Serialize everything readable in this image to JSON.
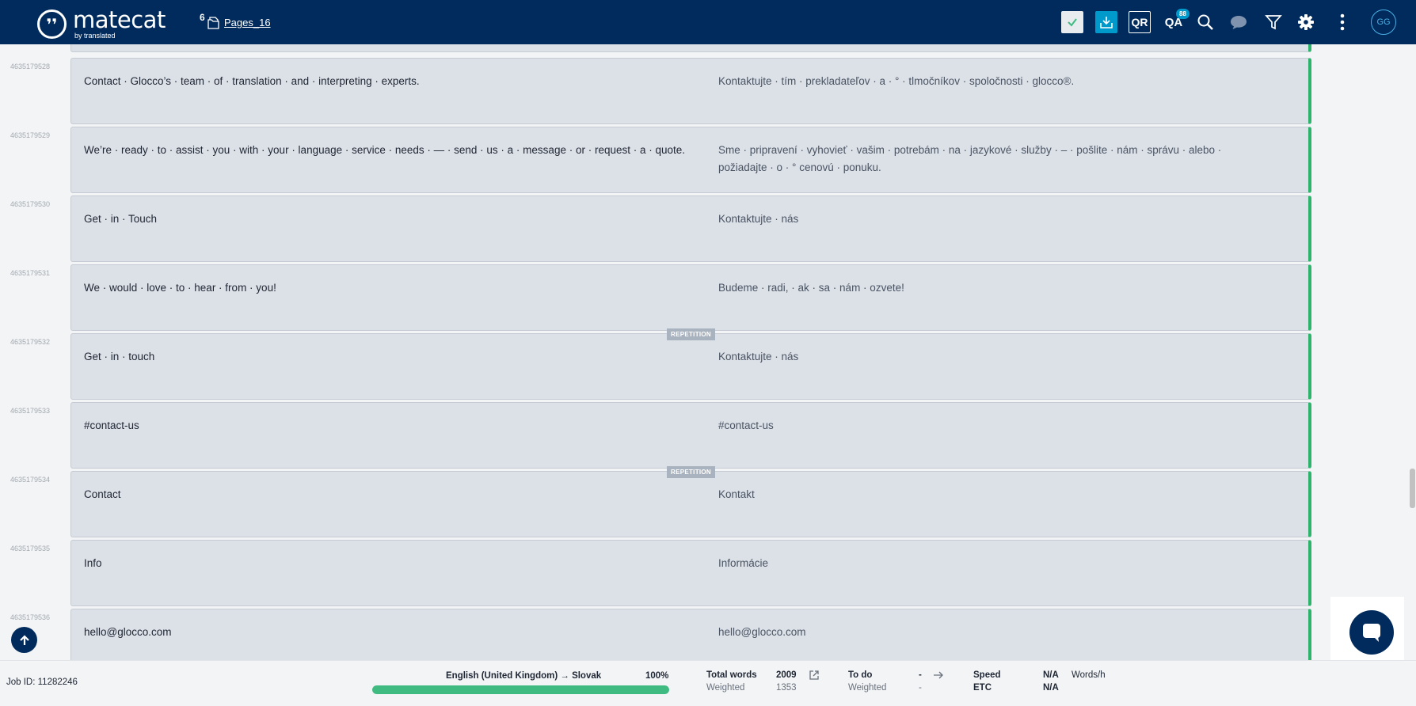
{
  "header": {
    "brand_name": "matecat",
    "brand_sub": "by translated",
    "pages_count": "6",
    "pages_name": "Pages_16",
    "qr_label": "QR",
    "qa_label": "QA",
    "qa_badge": "88",
    "avatar_initials": "GG"
  },
  "segments": [
    {
      "id": "4635179528",
      "source": "Contact · Glocco’s · team · of · translation · and · interpreting · experts.",
      "target": "Kontaktujte · tím · prekladateľov · a · ° · tlmočníkov · spoločnosti · glocco®.",
      "repetition": false
    },
    {
      "id": "4635179529",
      "source": "We’re · ready · to · assist · you · with · your · language · service · needs · — · send · us · a · message · or · request · a · quote.",
      "target": "Sme · pripravení · vyhovieť · vašim · potrebám · na · jazykové · služby · – · pošlite · nám · správu · alebo · požiadajte · o · ° cenovú · ponuku.",
      "repetition": false
    },
    {
      "id": "4635179530",
      "source": "Get · in · Touch",
      "target": "Kontaktujte · nás",
      "repetition": false
    },
    {
      "id": "4635179531",
      "source": "We · would · love · to · hear · from · you!",
      "target": "Budeme · radi, · ak · sa · nám · ozvete!",
      "repetition": false
    },
    {
      "id": "4635179532",
      "source": "Get · in · touch",
      "target": "Kontaktujte · nás",
      "repetition": true
    },
    {
      "id": "4635179533",
      "source": "#contact-us",
      "target": "#contact-us",
      "repetition": false
    },
    {
      "id": "4635179534",
      "source": "Contact",
      "target": "Kontakt",
      "repetition": true
    },
    {
      "id": "4635179535",
      "source": "Info",
      "target": "Informácie",
      "repetition": false
    },
    {
      "id": "4635179536",
      "source": "hello@glocco.com",
      "target": "hello@glocco.com",
      "repetition": false
    }
  ],
  "repetition_label": "REPETITION",
  "footer": {
    "job_id": "Job ID: 11282246",
    "language_pair": "English (United Kingdom) → Slovak",
    "progress_percent": "100%",
    "progress_value": 100,
    "total_words_label": "Total words",
    "total_words_value": "2009",
    "weighted_label": "Weighted",
    "weighted_value": "1353",
    "todo_label": "To do",
    "todo_value": "-",
    "todo_weighted_label": "Weighted",
    "todo_weighted_value": "-",
    "speed_label": "Speed",
    "speed_value": "N/A",
    "speed_unit": "Words/h",
    "etc_label": "ETC",
    "etc_value": "N/A"
  },
  "colors": {
    "header_bg": "#002b5c",
    "accent_blue": "#0099cc",
    "status_green": "#2db36c",
    "progress_green": "#3fbb82"
  }
}
